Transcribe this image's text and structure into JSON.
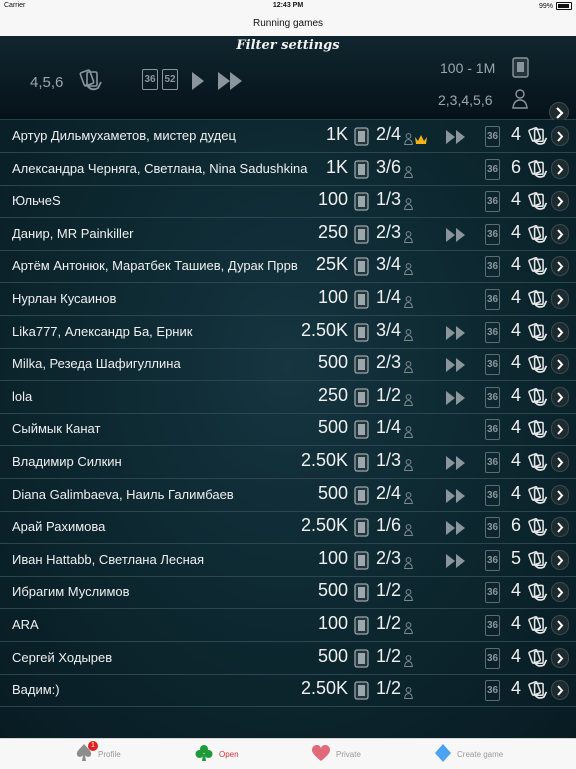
{
  "status": {
    "carrier": "Carrier",
    "time": "12:43 PM",
    "battery": "99%"
  },
  "nav": {
    "title": "Running games"
  },
  "filter": {
    "title": "Filter settings",
    "players": "4,5,6",
    "decks": [
      "36",
      "52"
    ],
    "bet_range": "100 - 1M",
    "player_counts": "2,3,4,5,6"
  },
  "games": [
    {
      "name": "Артур Дильмухаметов, мистер дудец",
      "bet": "1K",
      "seats": "2/4",
      "crown": true,
      "fast": true,
      "deck": "36",
      "hands": "4"
    },
    {
      "name": "Александра Черняга, Светлана, Nina Sadushkina",
      "bet": "1K",
      "seats": "3/6",
      "crown": false,
      "fast": false,
      "deck": "36",
      "hands": "6"
    },
    {
      "name": "ЮльчеS",
      "bet": "100",
      "seats": "1/3",
      "crown": false,
      "fast": false,
      "deck": "36",
      "hands": "4"
    },
    {
      "name": "Данир, MR Painkiller",
      "bet": "250",
      "seats": "2/3",
      "crown": false,
      "fast": true,
      "deck": "36",
      "hands": "4"
    },
    {
      "name": "Артём Антонюк, Маратбек Ташиев, Дурак Пррв",
      "bet": "25K",
      "seats": "3/4",
      "crown": false,
      "fast": false,
      "deck": "36",
      "hands": "4"
    },
    {
      "name": "Нурлан Кусаинов",
      "bet": "100",
      "seats": "1/4",
      "crown": false,
      "fast": false,
      "deck": "36",
      "hands": "4"
    },
    {
      "name": "Lika777, Александр Ба, Ерник",
      "bet": "2.50K",
      "seats": "3/4",
      "crown": false,
      "fast": true,
      "deck": "36",
      "hands": "4"
    },
    {
      "name": "Milka, Резеда Шафигуллина",
      "bet": "500",
      "seats": "2/3",
      "crown": false,
      "fast": true,
      "deck": "36",
      "hands": "4"
    },
    {
      "name": "lola",
      "bet": "250",
      "seats": "1/2",
      "crown": false,
      "fast": true,
      "deck": "36",
      "hands": "4"
    },
    {
      "name": "Сыймык Канат",
      "bet": "500",
      "seats": "1/4",
      "crown": false,
      "fast": false,
      "deck": "36",
      "hands": "4"
    },
    {
      "name": "Владимир Силкин",
      "bet": "2.50K",
      "seats": "1/3",
      "crown": false,
      "fast": true,
      "deck": "36",
      "hands": "4"
    },
    {
      "name": "Diana Galimbaeva, Наиль Галимбаев",
      "bet": "500",
      "seats": "2/4",
      "crown": false,
      "fast": true,
      "deck": "36",
      "hands": "4"
    },
    {
      "name": "Арай Рахимова",
      "bet": "2.50K",
      "seats": "1/6",
      "crown": false,
      "fast": true,
      "deck": "36",
      "hands": "6"
    },
    {
      "name": "Иван Hattabb, Светлана Лесная",
      "bet": "100",
      "seats": "2/3",
      "crown": false,
      "fast": true,
      "deck": "36",
      "hands": "5"
    },
    {
      "name": "Ибрагим Муслимов",
      "bet": "500",
      "seats": "1/2",
      "crown": false,
      "fast": false,
      "deck": "36",
      "hands": "4"
    },
    {
      "name": "ARA",
      "bet": "100",
      "seats": "1/2",
      "crown": false,
      "fast": false,
      "deck": "36",
      "hands": "4"
    },
    {
      "name": "Сергей Ходырев",
      "bet": "500",
      "seats": "1/2",
      "crown": false,
      "fast": false,
      "deck": "36",
      "hands": "4"
    },
    {
      "name": "Вадим:)",
      "bet": "2.50K",
      "seats": "1/2",
      "crown": false,
      "fast": false,
      "deck": "36",
      "hands": "4"
    }
  ],
  "tabs": [
    {
      "label": "Profile",
      "icon": "spade-icon",
      "badge": "1",
      "active": false
    },
    {
      "label": "Open",
      "icon": "club-icon",
      "active": true
    },
    {
      "label": "Private",
      "icon": "heart-icon",
      "active": false
    },
    {
      "label": "Create game",
      "icon": "diamond-icon",
      "active": false
    }
  ],
  "colors": {
    "accent_red": "#d8303a",
    "gold_crown": "#f2b318",
    "panel": "#0e2a33"
  }
}
